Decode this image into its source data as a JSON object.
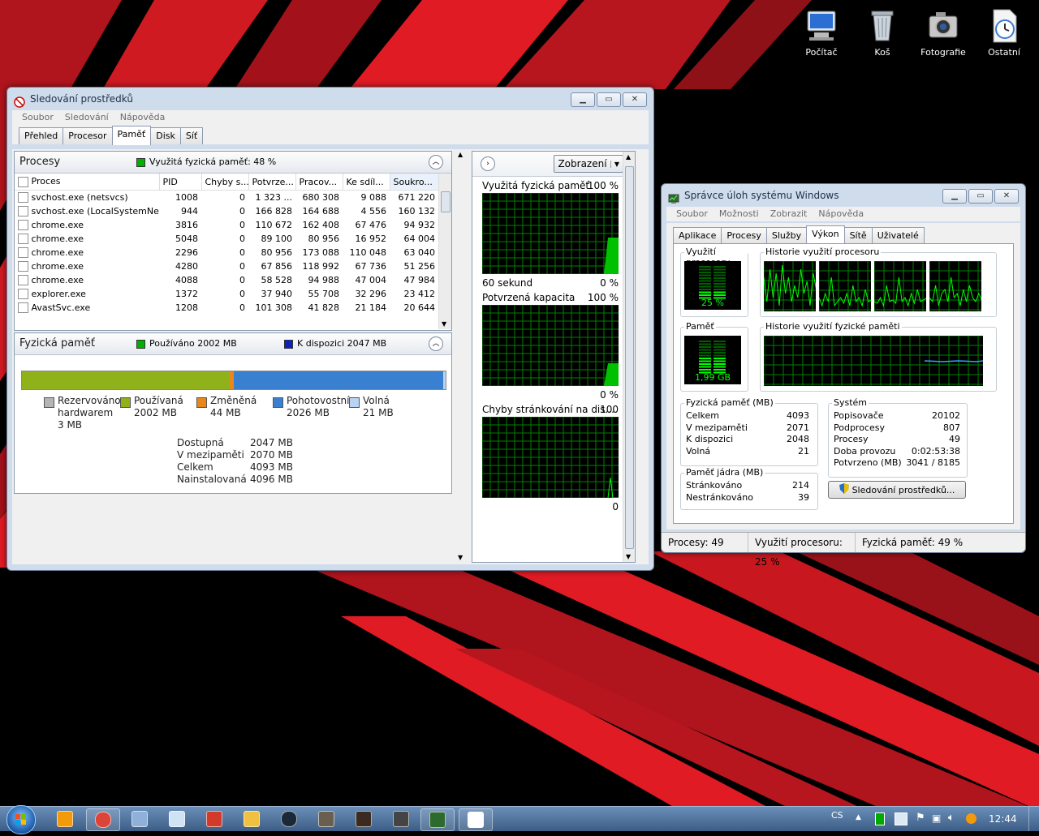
{
  "desktop": {
    "icons": [
      {
        "label": "Počítač",
        "icon": "computer-icon"
      },
      {
        "label": "Koš",
        "icon": "recycle-bin-icon"
      },
      {
        "label": "Fotografie",
        "icon": "camera-icon"
      },
      {
        "label": "Ostatní",
        "icon": "clock-icon"
      }
    ]
  },
  "resmon": {
    "title": "Sledování prostředků",
    "menu": [
      "Soubor",
      "Sledování",
      "Nápověda"
    ],
    "tabs": [
      "Přehled",
      "Procesor",
      "Paměť",
      "Disk",
      "Síť"
    ],
    "active_tab": "Paměť",
    "processes": {
      "title": "Procesy",
      "indicator": "Využitá fyzická paměť: 48 %",
      "columns": [
        "Proces",
        "PID",
        "Chyby s...",
        "Potvrze...",
        "Pracov...",
        "Ke sdíl...",
        "Soukro..."
      ],
      "rows": [
        [
          "svchost.exe (netsvcs)",
          "1008",
          "0",
          "1 323 ...",
          "680 308",
          "9 088",
          "671 220"
        ],
        [
          "svchost.exe (LocalSystemNet...",
          "944",
          "0",
          "166 828",
          "164 688",
          "4 556",
          "160 132"
        ],
        [
          "chrome.exe",
          "3816",
          "0",
          "110 672",
          "162 408",
          "67 476",
          "94 932"
        ],
        [
          "chrome.exe",
          "5048",
          "0",
          "89 100",
          "80 956",
          "16 952",
          "64 004"
        ],
        [
          "chrome.exe",
          "2296",
          "0",
          "80 956",
          "173 088",
          "110 048",
          "63 040"
        ],
        [
          "chrome.exe",
          "4280",
          "0",
          "67 856",
          "118 992",
          "67 736",
          "51 256"
        ],
        [
          "chrome.exe",
          "4088",
          "0",
          "58 528",
          "94 988",
          "47 004",
          "47 984"
        ],
        [
          "explorer.exe",
          "1372",
          "0",
          "37 940",
          "55 708",
          "32 296",
          "23 412"
        ],
        [
          "AvastSvc.exe",
          "1208",
          "0",
          "101 308",
          "41 828",
          "21 184",
          "20 644"
        ]
      ]
    },
    "physical": {
      "title": "Fyzická paměť",
      "used_label": "Používáno 2002 MB",
      "avail_label": "K dispozici 2047 MB",
      "bar_segments": [
        {
          "name": "Rezervováno hardwarem",
          "mb": 3,
          "color": "#b5b5b5"
        },
        {
          "name": "Používaná",
          "mb": 2002,
          "color": "#8fb21b"
        },
        {
          "name": "Změněná",
          "mb": 44,
          "color": "#e8881a"
        },
        {
          "name": "Pohotovostní",
          "mb": 2026,
          "color": "#3a80d0"
        },
        {
          "name": "Volná",
          "mb": 21,
          "color": "#b8d4f2"
        }
      ],
      "legend": [
        {
          "name": "Rezervováno",
          "line2": "hardwarem",
          "line3": "3 MB",
          "color": "#b5b5b5"
        },
        {
          "name": "Používaná",
          "line2": "2002 MB",
          "line3": "",
          "color": "#8fb21b"
        },
        {
          "name": "Změněná",
          "line2": "44 MB",
          "line3": "",
          "color": "#e8881a"
        },
        {
          "name": "Pohotovostní",
          "line2": "2026 MB",
          "line3": "",
          "color": "#3a80d0"
        },
        {
          "name": "Volná",
          "line2": "21 MB",
          "line3": "",
          "color": "#b8d4f2"
        }
      ],
      "stats": [
        {
          "label": "Dostupná",
          "value": "2047 MB"
        },
        {
          "label": "V mezipaměti",
          "value": "2070 MB"
        },
        {
          "label": "Celkem",
          "value": "4093 MB"
        },
        {
          "label": "Nainstalovaná",
          "value": "4096 MB"
        }
      ]
    },
    "charts": {
      "view_button": "Zobrazení",
      "graphs": [
        {
          "title": "Využitá fyzická paměť",
          "max": "100 %",
          "footer_left": "60 sekund",
          "footer_right": "0 %"
        },
        {
          "title": "Potvrzená kapacita",
          "max": "100 %",
          "footer_left": "",
          "footer_right": "0 %"
        },
        {
          "title": "Chyby stránkování na dis...",
          "max": "100",
          "footer_left": "",
          "footer_right": "0"
        }
      ]
    }
  },
  "taskmgr": {
    "title": "Správce úloh systému Windows",
    "menu": [
      "Soubor",
      "Možnosti",
      "Zobrazit",
      "Nápověda"
    ],
    "tabs": [
      "Aplikace",
      "Procesy",
      "Služby",
      "Výkon",
      "Sítě",
      "Uživatelé"
    ],
    "active_tab": "Výkon",
    "cpu_usage": {
      "title": "Využití procesoru",
      "value": "25 %"
    },
    "cpu_history": {
      "title": "Historie využití procesoru"
    },
    "memory": {
      "title": "Paměť",
      "value": "1,99 GB"
    },
    "mem_history": {
      "title": "Historie využití fyzické paměti"
    },
    "physical_memory": {
      "title": "Fyzická paměť (MB)",
      "rows": [
        {
          "label": "Celkem",
          "value": "4093"
        },
        {
          "label": "V mezipaměti",
          "value": "2071"
        },
        {
          "label": "K dispozici",
          "value": "2048"
        },
        {
          "label": "Volná",
          "value": "21"
        }
      ]
    },
    "kernel_memory": {
      "title": "Paměť jádra (MB)",
      "rows": [
        {
          "label": "Stránkováno",
          "value": "214"
        },
        {
          "label": "Nestránkováno",
          "value": "39"
        }
      ]
    },
    "system": {
      "title": "Systém",
      "rows": [
        {
          "label": "Popisovače",
          "value": "20102"
        },
        {
          "label": "Podprocesy",
          "value": "807"
        },
        {
          "label": "Procesy",
          "value": "49"
        },
        {
          "label": "Doba provozu",
          "value": "0:02:53:38"
        },
        {
          "label": "Potvrzeno (MB)",
          "value": "3041 / 8185"
        }
      ]
    },
    "resmon_button": "Sledování prostředků...",
    "status": {
      "processes": "Procesy: 49",
      "cpu": "Využití procesoru: 25 %",
      "memory": "Fyzická paměť: 49 %"
    }
  },
  "taskbar": {
    "items": [
      "start-orb",
      "avast-icon",
      "chrome-icon",
      "media-icon",
      "notepad-icon",
      "ccleaner-icon",
      "folder-tag-icon",
      "steam-icon",
      "gimp-icon",
      "game-icon",
      "shield-game-icon",
      "task-manager-icon",
      "resource-monitor-icon"
    ],
    "language": "CS",
    "clock": "12:44"
  },
  "colors": {
    "graph_bg": "#000000",
    "graph_grid": "#008000",
    "graph_line": "#00ff00",
    "wallpaper_red": "#e01b24"
  }
}
